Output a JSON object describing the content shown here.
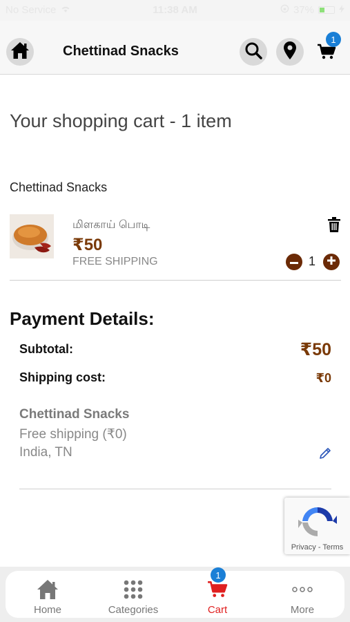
{
  "status_bar": {
    "carrier": "No Service",
    "time": "11:38 AM",
    "battery": "37%",
    "battery_level": 0.37
  },
  "header": {
    "title": "Chettinad Snacks",
    "cart_count": "1",
    "icons": [
      "home-icon",
      "search-icon",
      "location-pin-icon",
      "cart-icon"
    ]
  },
  "cart": {
    "heading": "Your shopping cart - 1 item",
    "seller": "Chettinad Snacks",
    "items": [
      {
        "name": "மிளகாய் பொடி",
        "price": "₹50",
        "shipping": "FREE SHIPPING",
        "quantity": "1"
      }
    ]
  },
  "payment": {
    "title": "Payment Details:",
    "subtotal_label": "Subtotal:",
    "subtotal_value": "₹50",
    "shipping_label": "Shipping cost:",
    "shipping_value": "₹0",
    "address_name": "Chettinad Snacks",
    "address_shipping": "Free shipping (₹0)",
    "address_location": "India, TN"
  },
  "recaptcha": {
    "links": "Privacy - Terms"
  },
  "bottom_nav": {
    "items": [
      {
        "label": "Home",
        "icon": "home-icon"
      },
      {
        "label": "Categories",
        "icon": "grid-icon"
      },
      {
        "label": "Cart",
        "icon": "cart-icon"
      },
      {
        "label": "More",
        "icon": "more-icon"
      }
    ],
    "cart_badge": "1",
    "active": "Cart"
  },
  "colors": {
    "accent_brown": "#7a3a08",
    "badge_blue": "#1a7fd6",
    "active_red": "#e02020"
  }
}
